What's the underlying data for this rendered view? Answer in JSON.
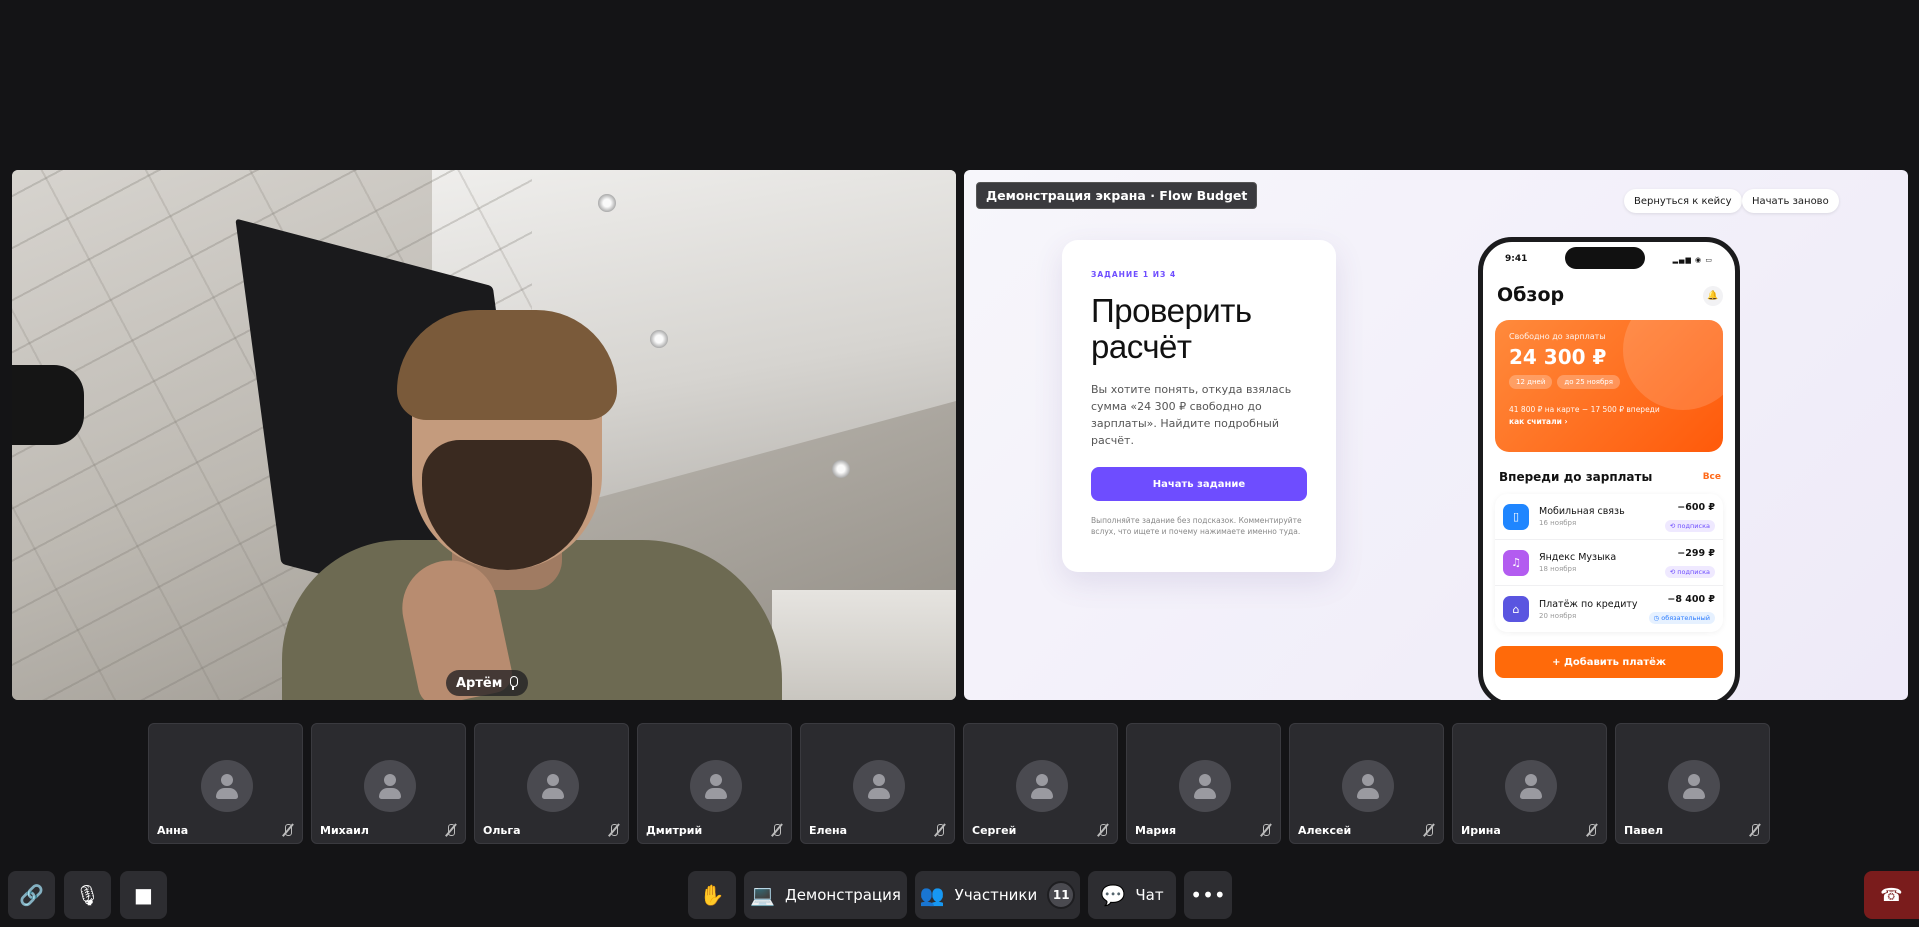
{
  "camera": {
    "participant_name": "Артём"
  },
  "screen_share": {
    "label": "Демонстрация экрана · Flow Budget",
    "back_button": "Вернуться к кейсу",
    "restart_button": "Начать заново",
    "task": {
      "step": "ЗАДАНИЕ 1 ИЗ 4",
      "title": "Проверить расчёт",
      "description": "Вы хотите понять, откуда взялась сумма «24 300 ₽ свободно до зарплаты». Найдите подробный расчёт.",
      "start_button": "Начать задание",
      "hint": "Выполняйте задание без подсказок. Комментируйте вслух, что ищете и почему нажимаете именно туда."
    },
    "phone": {
      "time": "9:41",
      "title": "Обзор",
      "balance": {
        "label": "Свободно до зарплаты",
        "amount": "24 300 ₽",
        "chip_days": "12 дней",
        "chip_date": "до 25 ноября",
        "footnote": "41 800 ₽ на карте − 17 500 ₽ впереди",
        "link": "как считали ›"
      },
      "upcoming_title": "Впереди до зарплаты",
      "upcoming_all": "Все",
      "payments": [
        {
          "name": "Мобильная связь",
          "date": "16 ноября",
          "amount": "−600 ₽",
          "tag": "⟲ подписка",
          "color": "#1f86ff",
          "icon": "▯"
        },
        {
          "name": "Яндекс Музыка",
          "date": "18 ноября",
          "amount": "−299 ₽",
          "tag": "⟲ подписка",
          "color": "#b35cf0",
          "icon": "♫"
        },
        {
          "name": "Платёж по кредиту",
          "date": "20 ноября",
          "amount": "−8 400 ₽",
          "tag": "◷ обязательный",
          "color": "#5a55e0",
          "icon": "⌂"
        }
      ],
      "add_button": "+ Добавить платёж"
    }
  },
  "participants": [
    "Анна",
    "Михаил",
    "Ольга",
    "Дмитрий",
    "Елена",
    "Сергей",
    "Мария",
    "Алексей",
    "Ирина",
    "Павел"
  ],
  "toolbar": {
    "share_label": "Демонстрация",
    "participants_label": "Участники",
    "participants_count": "11",
    "chat_label": "Чат"
  }
}
